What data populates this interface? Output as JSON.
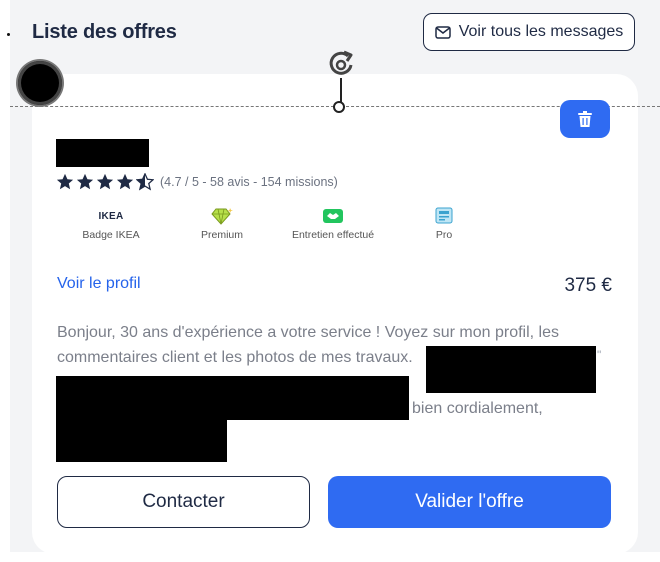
{
  "header": {
    "title": "Liste des offres",
    "all_messages_label": "Voir tous les messages"
  },
  "offer": {
    "rating_text": "(4.7 / 5 - 58 avis - 154 missions)",
    "rating_value": 4.7,
    "rating_max": 5,
    "badges": [
      {
        "mark": "IKEA",
        "label": "Badge IKEA",
        "icon": "ikea-logo"
      },
      {
        "mark": "",
        "label": "Premium",
        "icon": "diamond-icon"
      },
      {
        "mark": "",
        "label": "Entretien effectué",
        "icon": "handshake-icon"
      },
      {
        "mark": "",
        "label": "Pro",
        "icon": "pro-card-icon"
      }
    ],
    "profile_link": "Voir le profil",
    "price": "375 €",
    "message": {
      "line1": "Bonjour, 30 ans d'expérience a votre service ! Voyez sur mon profil, les",
      "line2": "commentaires client et les photos de mes travaux.",
      "quote_mark": "\"",
      "line3": "bien cordialement,"
    },
    "contact_label": "Contacter",
    "validate_label": "Valider l'offre"
  },
  "colors": {
    "accent": "#2f6bf2",
    "link": "#2563eb",
    "text_dark": "#1f2a44",
    "text_muted": "#7b7f8a"
  }
}
